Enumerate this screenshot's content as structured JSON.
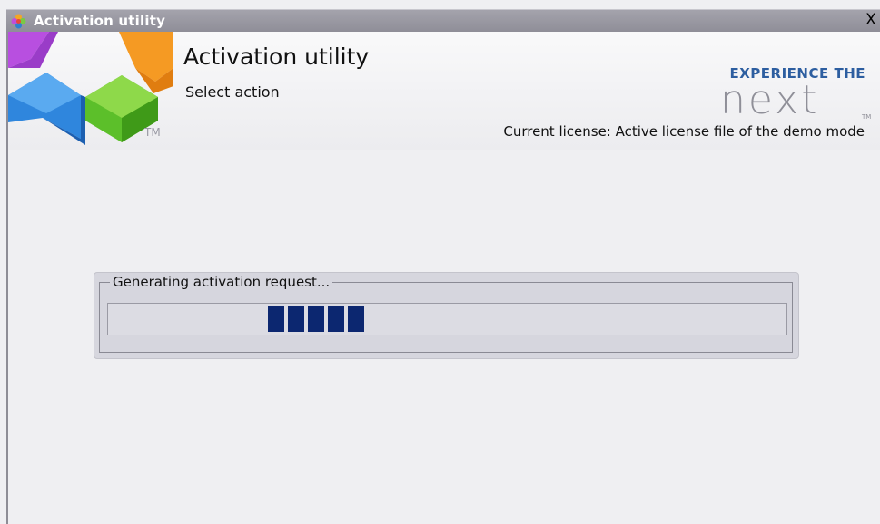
{
  "window": {
    "title": "Activation utility",
    "close_symbol": "X"
  },
  "header": {
    "title": "Activation utility",
    "subtitle": "Select action",
    "logo_icon": "colorful-cubes-logo-icon",
    "tm": "TM",
    "brand_tagline": "EXPERIENCE THE",
    "brand_word": "next",
    "brand_tm": "TM",
    "license_text": "Current license: Active license file of the demo mode"
  },
  "progress": {
    "label": "Generating activation request...",
    "indeterminate": true,
    "block_color": "#0c2770"
  },
  "colors": {
    "brand_blue": "#2d5ea0",
    "window_background": "#efeff2",
    "title_bar": "#9a99a3"
  }
}
